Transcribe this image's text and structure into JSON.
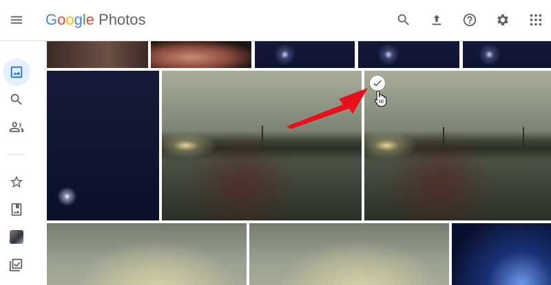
{
  "app": {
    "logo_letters": [
      "G",
      "o",
      "o",
      "g",
      "l",
      "e"
    ],
    "product": "Photos"
  },
  "header_icons": [
    "search-icon",
    "upload-icon",
    "help-icon",
    "settings-icon",
    "apps-grid-icon"
  ],
  "sidebar": {
    "items": [
      {
        "name": "photos",
        "icon": "photo-icon",
        "active": true
      },
      {
        "name": "explore",
        "icon": "search-icon",
        "active": false
      },
      {
        "name": "sharing",
        "icon": "people-icon",
        "active": false
      },
      {
        "name": "favorites",
        "icon": "star-icon",
        "active": false
      },
      {
        "name": "albums",
        "icon": "album-icon",
        "active": false
      },
      {
        "name": "utilities-thumb",
        "icon": "avatar-thumb",
        "active": false
      },
      {
        "name": "utilities",
        "icon": "checklist-icon",
        "active": false
      }
    ]
  },
  "selection": {
    "hovered_photo": "lake-photo-2",
    "check_icon": "checkmark-icon"
  },
  "colors": {
    "accent": "#1a73e8",
    "arrow": "#e8111b"
  }
}
